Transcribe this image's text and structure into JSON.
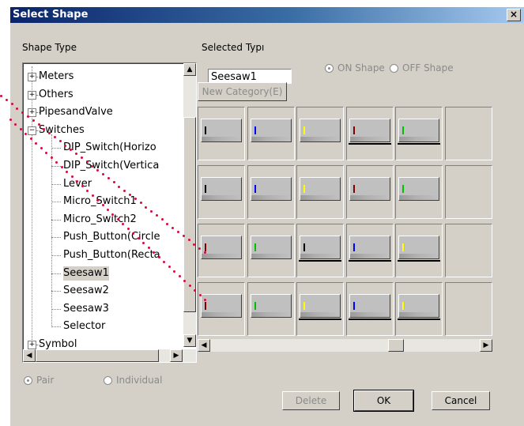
{
  "title": "Select Shape",
  "close_label": "×",
  "labels": {
    "shape_type": "Shape Type",
    "selected_type": "Selected Typı"
  },
  "tree": {
    "items": [
      {
        "label": "Meters",
        "expander": "+",
        "level": 0
      },
      {
        "label": "Others",
        "expander": "+",
        "level": 0
      },
      {
        "label": "PipesandValve",
        "expander": "+",
        "level": 0
      },
      {
        "label": "Switches",
        "expander": "−",
        "level": 0
      },
      {
        "label": "DIP_Switch(Horizo",
        "level": 1
      },
      {
        "label": "DIP_Switch(Vertica",
        "level": 1
      },
      {
        "label": "Lever",
        "level": 1
      },
      {
        "label": "Micro_Switch1",
        "level": 1
      },
      {
        "label": "Micro_Switch2",
        "level": 1
      },
      {
        "label": "Push_Button(Circle",
        "level": 1
      },
      {
        "label": "Push_Button(Recta",
        "level": 1
      },
      {
        "label": "Seesaw1",
        "level": 1,
        "selected": true
      },
      {
        "label": "Seesaw2",
        "level": 1
      },
      {
        "label": "Seesaw3",
        "level": 1
      },
      {
        "label": "Selector",
        "level": 1
      },
      {
        "label": "Symbol",
        "expander": "+",
        "level": 0
      }
    ]
  },
  "selected_value": "Seesaw1",
  "new_category_label": "New Category(E)",
  "on_shape_label": "ON Shape",
  "off_shape_label": "OFF Shape",
  "pair_label": "Pair",
  "individual_label": "Individual",
  "buttons": {
    "delete": "Delete",
    "ok": "OK",
    "cancel": "Cancel"
  },
  "grid": {
    "rows": [
      [
        {
          "color": "#000000",
          "style": "on"
        },
        {
          "color": "#0000ff",
          "style": "on"
        },
        {
          "color": "#ffff00",
          "style": "on"
        },
        {
          "color": "#800000",
          "style": "off"
        },
        {
          "color": "#00c000",
          "style": "off"
        },
        {
          "empty": true
        }
      ],
      [
        {
          "color": "#000000",
          "style": "on"
        },
        {
          "color": "#0000ff",
          "style": "on"
        },
        {
          "color": "#ffff00",
          "style": "on"
        },
        {
          "color": "#800000",
          "style": "on"
        },
        {
          "color": "#00c000",
          "style": "on"
        },
        {
          "empty": true
        }
      ],
      [
        {
          "color": "#800000",
          "style": "on"
        },
        {
          "color": "#00c000",
          "style": "on"
        },
        {
          "color": "#000000",
          "style": "off"
        },
        {
          "color": "#0000ff",
          "style": "off"
        },
        {
          "color": "#ffff00",
          "style": "off"
        },
        {
          "empty": true
        }
      ],
      [
        {
          "color": "#800000",
          "style": "on"
        },
        {
          "color": "#00c000",
          "style": "on"
        },
        {
          "color": "#ffff00",
          "style": "off"
        },
        {
          "color": "#0000ff",
          "style": "off"
        },
        {
          "color": "#ffff00",
          "style": "off"
        },
        {
          "empty": true
        }
      ]
    ]
  },
  "colors": {
    "title_bar": "#0a246a",
    "dialog_bg": "#d4d0c8",
    "annotation_dots": "#e8003c"
  }
}
